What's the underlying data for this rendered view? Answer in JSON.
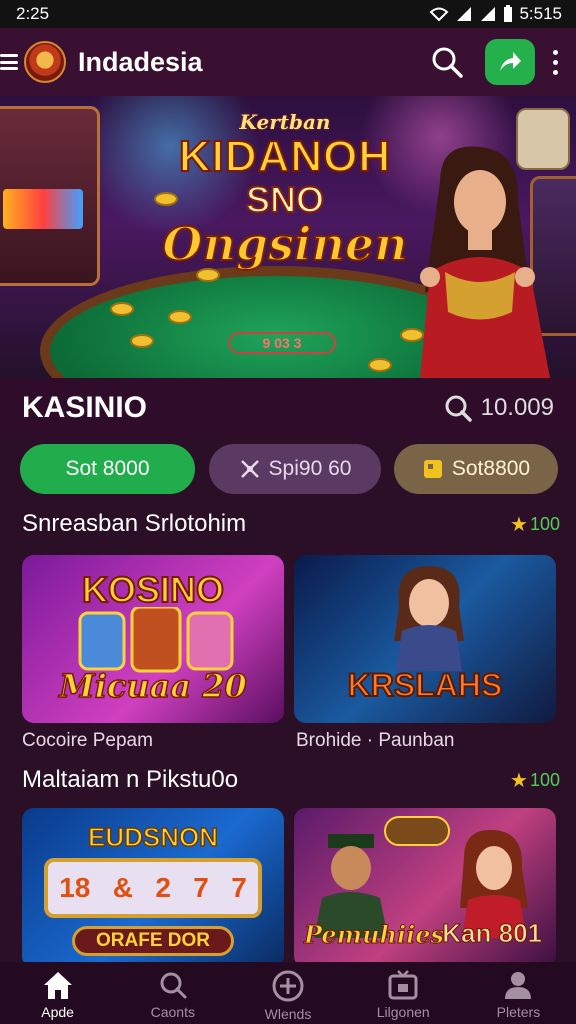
{
  "status_bar": {
    "time": "2:25",
    "clock_right": "5:515"
  },
  "app_bar": {
    "title": "Indadesia"
  },
  "hero": {
    "line1": "Kertban",
    "line2": "KIDANOH",
    "line3": "SNO",
    "line4": "Ongsinen",
    "table_label": "9 03 3"
  },
  "section": {
    "title": "KASINIO",
    "search_value": "10.009"
  },
  "chips": [
    {
      "label": "Sot 8000",
      "color": "#22ad4c"
    },
    {
      "label": "Spi90 60",
      "color": "#5a3a62"
    },
    {
      "label": "Sot8800",
      "color": "#7a6448"
    }
  ],
  "rows": [
    {
      "title": "Snreasban Srlotohim",
      "rating": "100",
      "cards": [
        {
          "caption": "Cocoire Pepam",
          "art_title": "KOSINO",
          "art_sub": "Micuaa 20"
        },
        {
          "caption": "Brohide · Paunban",
          "art_title": "KRSLAHS",
          "art_sub": ""
        }
      ]
    },
    {
      "title": "Maltaiam n Pikstu0o",
      "rating": "100",
      "cards": [
        {
          "art_title": "EUDSNON",
          "art_sub": "ORAFE DOR",
          "reels": [
            "18",
            "&",
            "2",
            "7",
            "7"
          ]
        },
        {
          "art_title": "Pemuhiies",
          "art_sub": "Kan 801"
        }
      ]
    }
  ],
  "bottom_nav": [
    {
      "label": "Apde",
      "icon": "home-icon",
      "active": true
    },
    {
      "label": "Caonts",
      "icon": "search-icon",
      "active": false
    },
    {
      "label": "Wlends",
      "icon": "plus-circle-icon",
      "active": false
    },
    {
      "label": "Lilgonen",
      "icon": "tv-icon",
      "active": false
    },
    {
      "label": "Pleters",
      "icon": "profile-icon",
      "active": false
    }
  ],
  "colors": {
    "background": "#2a0f26",
    "app_bar": "#3a1032",
    "accent_green": "#22ad4c",
    "rating_green": "#4ecf5a",
    "star": "#f2c21e"
  }
}
